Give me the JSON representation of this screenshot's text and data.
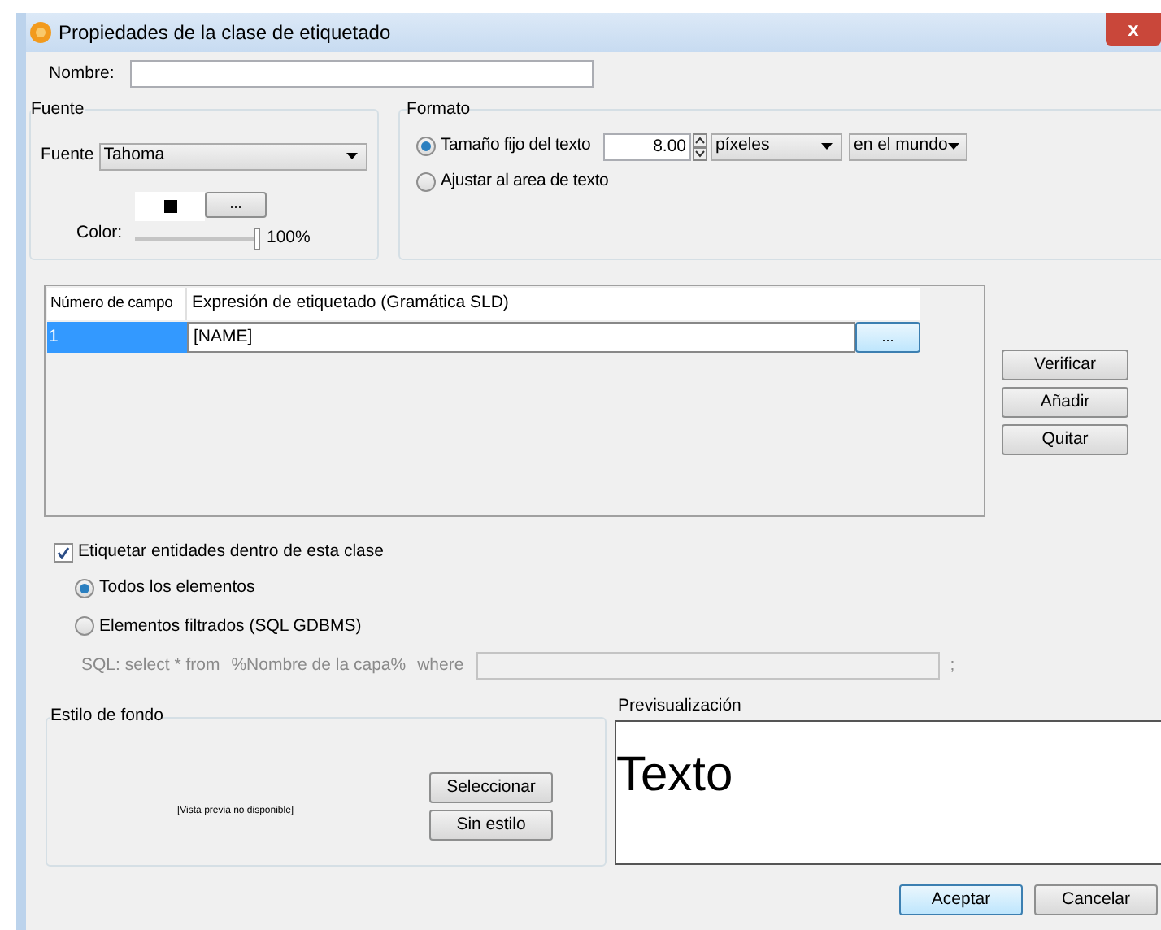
{
  "window": {
    "title": "Propiedades de la clase de etiquetado",
    "close": "x"
  },
  "nombre": {
    "label": "Nombre:"
  },
  "fuente": {
    "title": "Fuente",
    "font_label": "Fuente",
    "font": "Tahoma",
    "color_label": "Color:",
    "color": "#000000",
    "color_button": "...",
    "opacity": {
      "level": 1,
      "reading": "100%"
    }
  },
  "formato": {
    "title": "Formato",
    "options": [
      {
        "label": "Tamaño fijo del texto",
        "selected": true
      },
      {
        "label": "Ajustar al area de texto",
        "selected": false
      }
    ],
    "size": "8.00",
    "units": "píxeles",
    "reference": "en el mundo"
  },
  "fields_table": {
    "columns": [
      "Número de campo",
      "Expresión de etiquetado (Gramática SLD)"
    ],
    "rows": [
      {
        "number": "1",
        "expression": "[NAME]",
        "button": "...",
        "selected": true
      }
    ]
  },
  "side_buttons": [
    "Verificar",
    "Añadir",
    "Quitar"
  ],
  "label_entities": {
    "label": "Etiquetar entidades dentro de esta clase",
    "checked": true
  },
  "scope": [
    {
      "label": "Todos los elementos",
      "selected": true
    },
    {
      "label": "Elementos filtrados (SQL GDBMS)",
      "selected": false
    }
  ],
  "sql": {
    "prefix": "SQL: select * from",
    "layer": "%Nombre de la capa%",
    "where": "where",
    "suffix": ";",
    "disabled": true
  },
  "background_style": {
    "title": "Estilo de fondo",
    "preview": "[Vista previa no disponible]",
    "buttons": [
      "Seleccionar",
      "Sin estilo"
    ]
  },
  "preview": {
    "title": "Previsualización",
    "text": "Texto"
  },
  "buttons": [
    {
      "label": "Aceptar",
      "default": true
    },
    {
      "label": "Cancelar",
      "default": false
    }
  ]
}
